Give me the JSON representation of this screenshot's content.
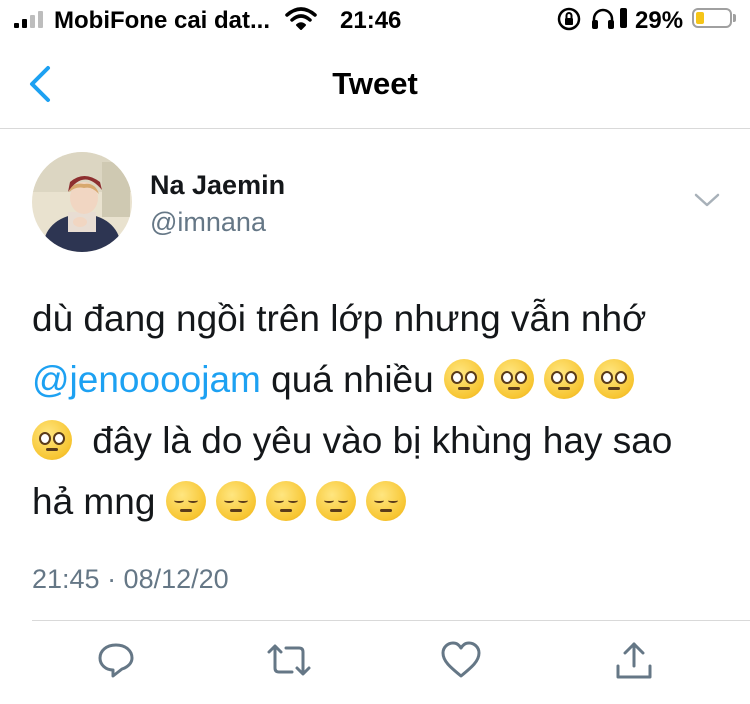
{
  "status_bar": {
    "carrier": "MobiFone cai dat...",
    "time": "21:46",
    "battery_percent": "29%",
    "battery_level": 0.29,
    "icons": [
      "signal-icon",
      "wifi-icon",
      "rotation-lock-icon",
      "headphones-icon",
      "battery-icon"
    ]
  },
  "nav": {
    "title": "Tweet",
    "back_icon": "chevron-left-icon"
  },
  "tweet": {
    "author_name": "Na Jaemin",
    "author_handle": "@imnana",
    "text_line1": "dù đang ngồi trên lớp nhưng vẫn nhớ",
    "mention": "@jenoooojam",
    "text_part2": "quá nhiều",
    "text_part3": "đây là do yêu vào bị khùng hay sao",
    "text_part4": "hả mng",
    "emojis": {
      "pleading": "pleading-face-emoji",
      "pensive": "pensive-face-emoji"
    },
    "timestamp": "21:45 · 08/12/20"
  },
  "actions": [
    "reply-icon",
    "retweet-icon",
    "like-icon",
    "share-icon"
  ],
  "colors": {
    "accent": "#1da1f2",
    "secondary_text": "#657786",
    "divider": "#d9d9d9"
  }
}
